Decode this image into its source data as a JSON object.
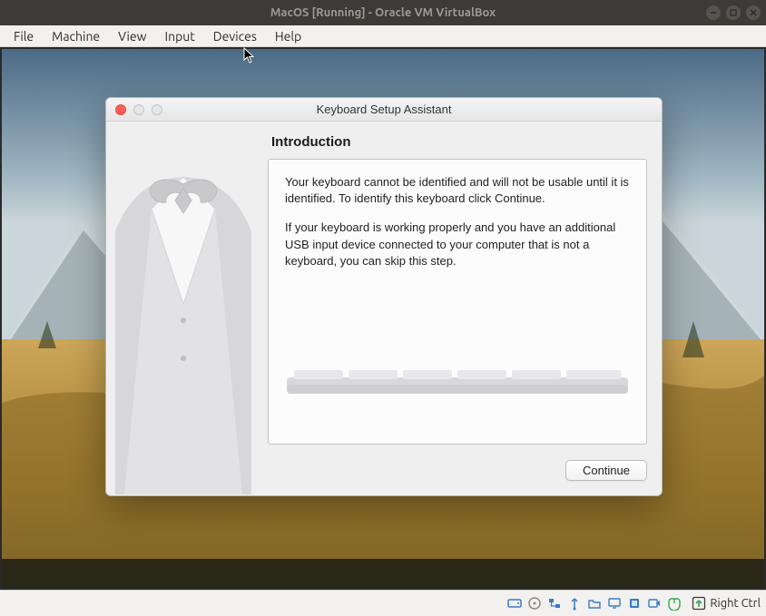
{
  "window": {
    "title": "MacOS [Running] - Oracle VM VirtualBox"
  },
  "menubar": {
    "items": [
      "File",
      "Machine",
      "View",
      "Input",
      "Devices",
      "Help"
    ]
  },
  "assistant": {
    "window_title": "Keyboard Setup Assistant",
    "heading": "Introduction",
    "paragraph1": "Your keyboard cannot be identified and will not be usable until it is identified. To identify this keyboard click Continue.",
    "paragraph2": "If your keyboard is working properly and you have an additional USB input device connected to your computer that is not a keyboard, you can skip this step.",
    "continue_label": "Continue"
  },
  "statusbar": {
    "hostkey_label": "Right Ctrl",
    "icons": [
      "hard-disk-icon",
      "optical-disk-icon",
      "network-icon",
      "usb-icon",
      "shared-folder-icon",
      "display-icon",
      "audio-icon",
      "recording-icon",
      "clipboard-icon",
      "capture-icon"
    ]
  }
}
